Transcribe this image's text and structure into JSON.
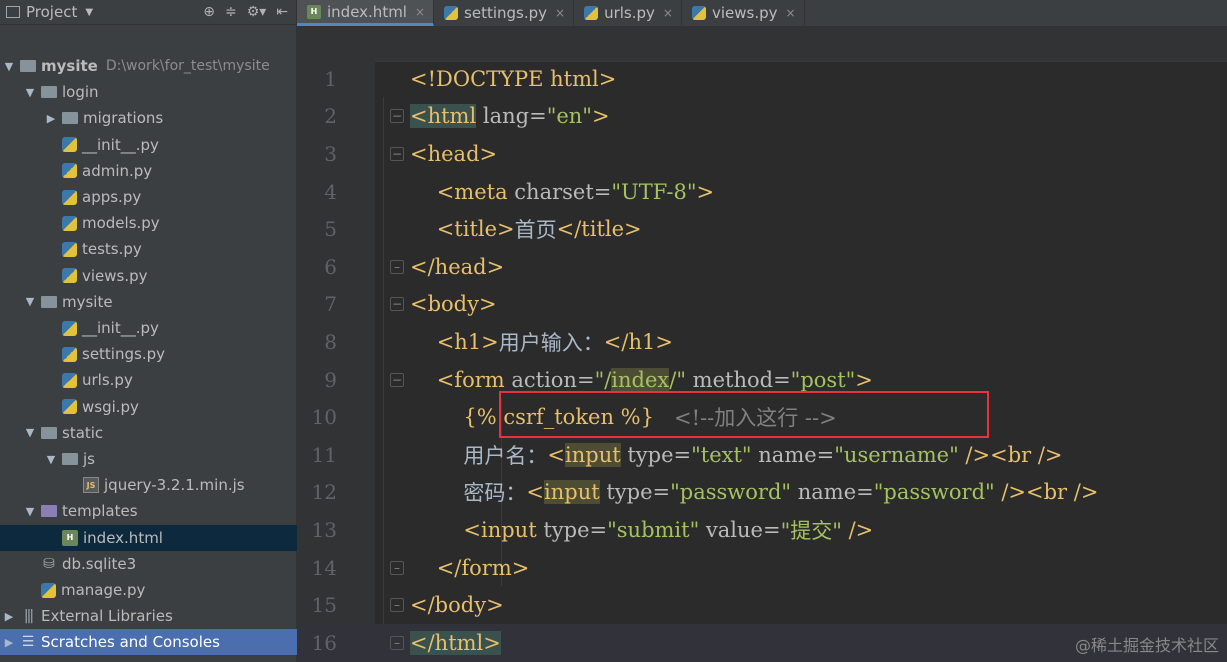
{
  "project_header": {
    "title": "Project"
  },
  "tree": [
    {
      "indent": 0,
      "arrow": "down",
      "icon": "folder-icon",
      "label": "mysite",
      "bold": true,
      "path": "D:\\work\\for_test\\mysite"
    },
    {
      "indent": 1,
      "arrow": "down",
      "icon": "folder-icon",
      "label": "login"
    },
    {
      "indent": 2,
      "arrow": "right",
      "icon": "folder-icon",
      "label": "migrations"
    },
    {
      "indent": 2,
      "arrow": "",
      "icon": "python-file-icon",
      "label": "__init__.py"
    },
    {
      "indent": 2,
      "arrow": "",
      "icon": "python-file-icon",
      "label": "admin.py"
    },
    {
      "indent": 2,
      "arrow": "",
      "icon": "python-file-icon",
      "label": "apps.py"
    },
    {
      "indent": 2,
      "arrow": "",
      "icon": "python-file-icon",
      "label": "models.py"
    },
    {
      "indent": 2,
      "arrow": "",
      "icon": "python-file-icon",
      "label": "tests.py"
    },
    {
      "indent": 2,
      "arrow": "",
      "icon": "python-file-icon",
      "label": "views.py"
    },
    {
      "indent": 1,
      "arrow": "down",
      "icon": "folder-icon",
      "label": "mysite"
    },
    {
      "indent": 2,
      "arrow": "",
      "icon": "python-file-icon",
      "label": "__init__.py"
    },
    {
      "indent": 2,
      "arrow": "",
      "icon": "python-file-icon",
      "label": "settings.py"
    },
    {
      "indent": 2,
      "arrow": "",
      "icon": "python-file-icon",
      "label": "urls.py"
    },
    {
      "indent": 2,
      "arrow": "",
      "icon": "python-file-icon",
      "label": "wsgi.py"
    },
    {
      "indent": 1,
      "arrow": "down",
      "icon": "folder-icon",
      "label": "static"
    },
    {
      "indent": 2,
      "arrow": "down",
      "icon": "folder-icon",
      "label": "js"
    },
    {
      "indent": 3,
      "arrow": "",
      "icon": "js-file-icon",
      "label": "jquery-3.2.1.min.js"
    },
    {
      "indent": 1,
      "arrow": "down",
      "icon": "templates-folder-icon",
      "label": "templates"
    },
    {
      "indent": 2,
      "arrow": "",
      "icon": "html-file-icon",
      "label": "index.html",
      "selected": true
    },
    {
      "indent": 1,
      "arrow": "",
      "icon": "database-icon",
      "label": "db.sqlite3"
    },
    {
      "indent": 1,
      "arrow": "",
      "icon": "python-file-icon",
      "label": "manage.py"
    },
    {
      "indent": 0,
      "arrow": "right",
      "icon": "library-icon",
      "label": "External Libraries"
    },
    {
      "indent": 0,
      "arrow": "right",
      "icon": "scratches-icon",
      "label": "Scratches and Consoles",
      "highlight": true
    }
  ],
  "tabs": [
    {
      "label": "index.html",
      "icon": "html-file-icon",
      "active": true
    },
    {
      "label": "settings.py",
      "icon": "python-file-icon"
    },
    {
      "label": "urls.py",
      "icon": "python-file-icon"
    },
    {
      "label": "views.py",
      "icon": "python-file-icon"
    }
  ],
  "code_lines": [
    {
      "n": "1",
      "fold": "",
      "current": false,
      "tokens": [
        [
          "t-tag",
          "<!DOCTYPE html>"
        ]
      ]
    },
    {
      "n": "2",
      "fold": "open",
      "current": false,
      "tokens": [
        [
          "t-tag hl-tag",
          "<html"
        ],
        [
          "t-attr",
          " lang="
        ],
        [
          "t-val",
          "\"en\""
        ],
        [
          "t-tag",
          ">"
        ]
      ]
    },
    {
      "n": "3",
      "fold": "open",
      "current": false,
      "tokens": [
        [
          "t-tag",
          "<head>"
        ]
      ]
    },
    {
      "n": "4",
      "fold": "",
      "current": false,
      "tokens": [
        [
          "t-text",
          "    "
        ],
        [
          "t-tag",
          "<meta"
        ],
        [
          "t-attr",
          " charset="
        ],
        [
          "t-val",
          "\"UTF-8\""
        ],
        [
          "t-tag",
          ">"
        ]
      ]
    },
    {
      "n": "5",
      "fold": "",
      "current": false,
      "tokens": [
        [
          "t-text",
          "    "
        ],
        [
          "t-tag",
          "<title>"
        ],
        [
          "t-text",
          "首页"
        ],
        [
          "t-tag",
          "</title>"
        ]
      ]
    },
    {
      "n": "6",
      "fold": "close",
      "current": false,
      "tokens": [
        [
          "t-tag",
          "</head>"
        ]
      ]
    },
    {
      "n": "7",
      "fold": "open",
      "current": false,
      "tokens": [
        [
          "t-tag",
          "<body>"
        ]
      ]
    },
    {
      "n": "8",
      "fold": "",
      "current": false,
      "tokens": [
        [
          "t-text",
          "    "
        ],
        [
          "t-tag",
          "<h1>"
        ],
        [
          "t-text",
          "用户输入："
        ],
        [
          "t-tag",
          "</h1>"
        ]
      ]
    },
    {
      "n": "9",
      "fold": "open",
      "current": false,
      "tokens": [
        [
          "t-text",
          "    "
        ],
        [
          "t-tag",
          "<form"
        ],
        [
          "t-attr",
          " action="
        ],
        [
          "t-val",
          "\"/"
        ],
        [
          "t-val hl-word",
          "index"
        ],
        [
          "t-val",
          "/\""
        ],
        [
          "t-attr",
          " method="
        ],
        [
          "t-val",
          "\"post\""
        ],
        [
          "t-tag",
          ">"
        ]
      ]
    },
    {
      "n": "10",
      "fold": "",
      "current": false,
      "tokens": [
        [
          "t-text",
          "        "
        ],
        [
          "t-tpl",
          "{% csrf_token %}"
        ],
        [
          "t-text",
          "   "
        ],
        [
          "t-cmt",
          "<!--加入这行 -->"
        ]
      ]
    },
    {
      "n": "11",
      "fold": "",
      "current": false,
      "tokens": [
        [
          "t-text",
          "        用户名："
        ],
        [
          "t-tag",
          "<"
        ],
        [
          "t-tag hl-word",
          "input"
        ],
        [
          "t-attr",
          " type="
        ],
        [
          "t-val",
          "\"text\""
        ],
        [
          "t-attr",
          " name="
        ],
        [
          "t-val",
          "\"username\""
        ],
        [
          "t-tag",
          " /><br />"
        ]
      ]
    },
    {
      "n": "12",
      "fold": "",
      "current": false,
      "tokens": [
        [
          "t-text",
          "        密码："
        ],
        [
          "t-tag",
          "<"
        ],
        [
          "t-tag hl-word",
          "input"
        ],
        [
          "t-attr",
          " type="
        ],
        [
          "t-val",
          "\"password\""
        ],
        [
          "t-attr",
          " name="
        ],
        [
          "t-val",
          "\"password\""
        ],
        [
          "t-tag",
          " /><br />"
        ]
      ]
    },
    {
      "n": "13",
      "fold": "",
      "current": false,
      "tokens": [
        [
          "t-text",
          "        "
        ],
        [
          "t-tag",
          "<input"
        ],
        [
          "t-attr",
          " type="
        ],
        [
          "t-val",
          "\"submit\""
        ],
        [
          "t-attr",
          " value="
        ],
        [
          "t-val",
          "\"提交\""
        ],
        [
          "t-tag",
          " />"
        ]
      ]
    },
    {
      "n": "14",
      "fold": "close",
      "current": false,
      "tokens": [
        [
          "t-text",
          "    "
        ],
        [
          "t-tag",
          "</form>"
        ]
      ]
    },
    {
      "n": "15",
      "fold": "close",
      "current": false,
      "tokens": [
        [
          "t-tag",
          "</body>"
        ]
      ]
    },
    {
      "n": "16",
      "fold": "close",
      "current": true,
      "tokens": [
        [
          "t-tag hl-tag",
          "</html>"
        ]
      ]
    }
  ],
  "watermark": "@稀土掘金技术社区",
  "colors": {
    "accent": "#4a88c7",
    "annotation_box": "#e8333a",
    "selection": "#4b6eaf"
  }
}
